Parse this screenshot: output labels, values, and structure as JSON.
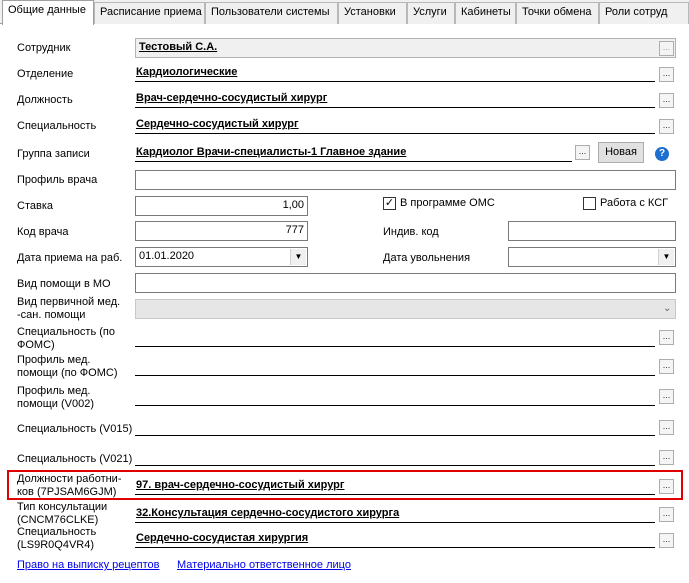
{
  "tabs": [
    {
      "label": "Общие данные"
    },
    {
      "label": "Расписание приема"
    },
    {
      "label": "Пользователи системы"
    },
    {
      "label": "Установки"
    },
    {
      "label": "Услуги"
    },
    {
      "label": "Кабинеты"
    },
    {
      "label": "Точки обмена"
    },
    {
      "label": "Роли сотруд"
    }
  ],
  "form": {
    "employee_label": "Сотрудник",
    "employee_value": "Тестовый С.А.",
    "department_label": "Отделение",
    "department_value": "Кардиологические",
    "position_label": "Должность",
    "position_value": "Врач-сердечно-сосудистый хирург",
    "specialty_label": "Специальность",
    "specialty_value": "Сердечно-сосудистый хирург",
    "group_label": "Группа записи",
    "group_value": "Кардиолог Врачи-специалисты-1 Главное здание",
    "new_button": "Новая",
    "profile_label": "Профиль врача",
    "profile_value": "",
    "rate_label": "Ставка",
    "rate_value": "1,00",
    "oms_label": "В программе ОМС",
    "ksg_label": "Работа с КСГ",
    "doc_code_label": "Код врача",
    "doc_code_value": "777",
    "indiv_code_label": "Индив. код",
    "indiv_code_value": "",
    "hire_date_label": "Дата приема на раб.",
    "hire_date_value": "01.01.2020",
    "dismiss_label": "Дата увольнения",
    "dismiss_value": "",
    "help_type_label": "Вид помощи в МО",
    "primary_help_label": "Вид первичной мед. -сан. помощи",
    "foms_spec_label": "Специальность (по ФОМС)",
    "foms_profile_label": "Профиль  мед. помощи (по ФОМС)",
    "v002_label": "Профиль  мед. помощи (V002)",
    "v015_label": "Специальность (V015)",
    "v021_label": "Специальность (V021)",
    "worker_pos_label": "Должности работни- ков (7PJSAM6GJM)",
    "worker_pos_value": "97. врач-сердечно-сосудистый хирург",
    "consult_label": "Тип консультации (CNCM76CLKE)",
    "consult_value": "32.Консультация сердечно-сосудистого хирурга",
    "spec2_label": "Специальность (LS9R0Q4VR4)",
    "spec2_value": "Сердечно-сосудистая хирургия"
  },
  "links": {
    "prescriptions": "Право на выписку рецептов",
    "responsible": "Материально ответственное лицо"
  },
  "icons": {
    "ellipsis": "...",
    "dropdown": "▼",
    "check": "✓",
    "help": "?"
  },
  "colors": {
    "highlight": "#e00000",
    "link": "#0000ee",
    "help_icon": "#1f6fd1"
  }
}
